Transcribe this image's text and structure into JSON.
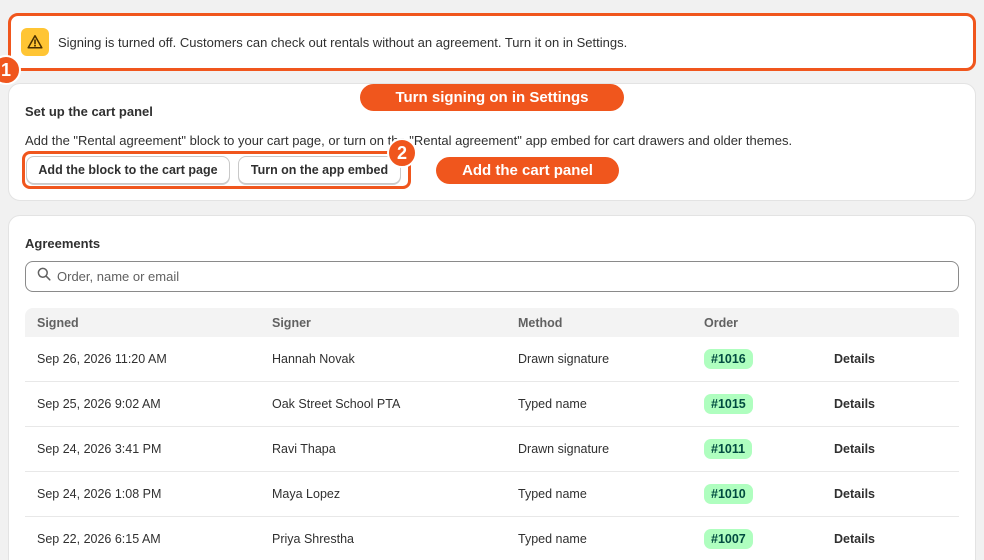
{
  "banner": {
    "text": "Signing is turned off. Customers can check out rentals without an agreement. Turn it on in Settings.",
    "step": "1",
    "accent_color": "#f0561d",
    "icon": "warning-icon"
  },
  "callouts": {
    "settings": "Turn signing on in Settings",
    "cart_panel": "Add the cart panel",
    "step2": "2"
  },
  "cart_panel": {
    "title": "Set up the cart panel",
    "description": "Add the \"Rental agreement\" block to your cart page, or turn on the \"Rental agreement\" app embed for cart drawers and older themes.",
    "add_block_label": "Add the block to the cart page",
    "app_embed_label": "Turn on the app embed"
  },
  "agreements": {
    "title": "Agreements",
    "search_placeholder": "Order, name or email",
    "columns": [
      "Signed",
      "Signer",
      "Method",
      "Order",
      ""
    ],
    "rows": [
      {
        "signed": "Sep 26, 2026 11:20 AM",
        "signer": "Hannah Novak",
        "method": "Drawn signature",
        "order": "#1016",
        "action": "Details"
      },
      {
        "signed": "Sep 25, 2026 9:02 AM",
        "signer": "Oak Street School PTA",
        "method": "Typed name",
        "order": "#1015",
        "action": "Details"
      },
      {
        "signed": "Sep 24, 2026 3:41 PM",
        "signer": "Ravi Thapa",
        "method": "Drawn signature",
        "order": "#1011",
        "action": "Details"
      },
      {
        "signed": "Sep 24, 2026 1:08 PM",
        "signer": "Maya Lopez",
        "method": "Typed name",
        "order": "#1010",
        "action": "Details"
      },
      {
        "signed": "Sep 22, 2026 6:15 AM",
        "signer": "Priya Shrestha",
        "method": "Typed name",
        "order": "#1007",
        "action": "Details"
      }
    ]
  }
}
